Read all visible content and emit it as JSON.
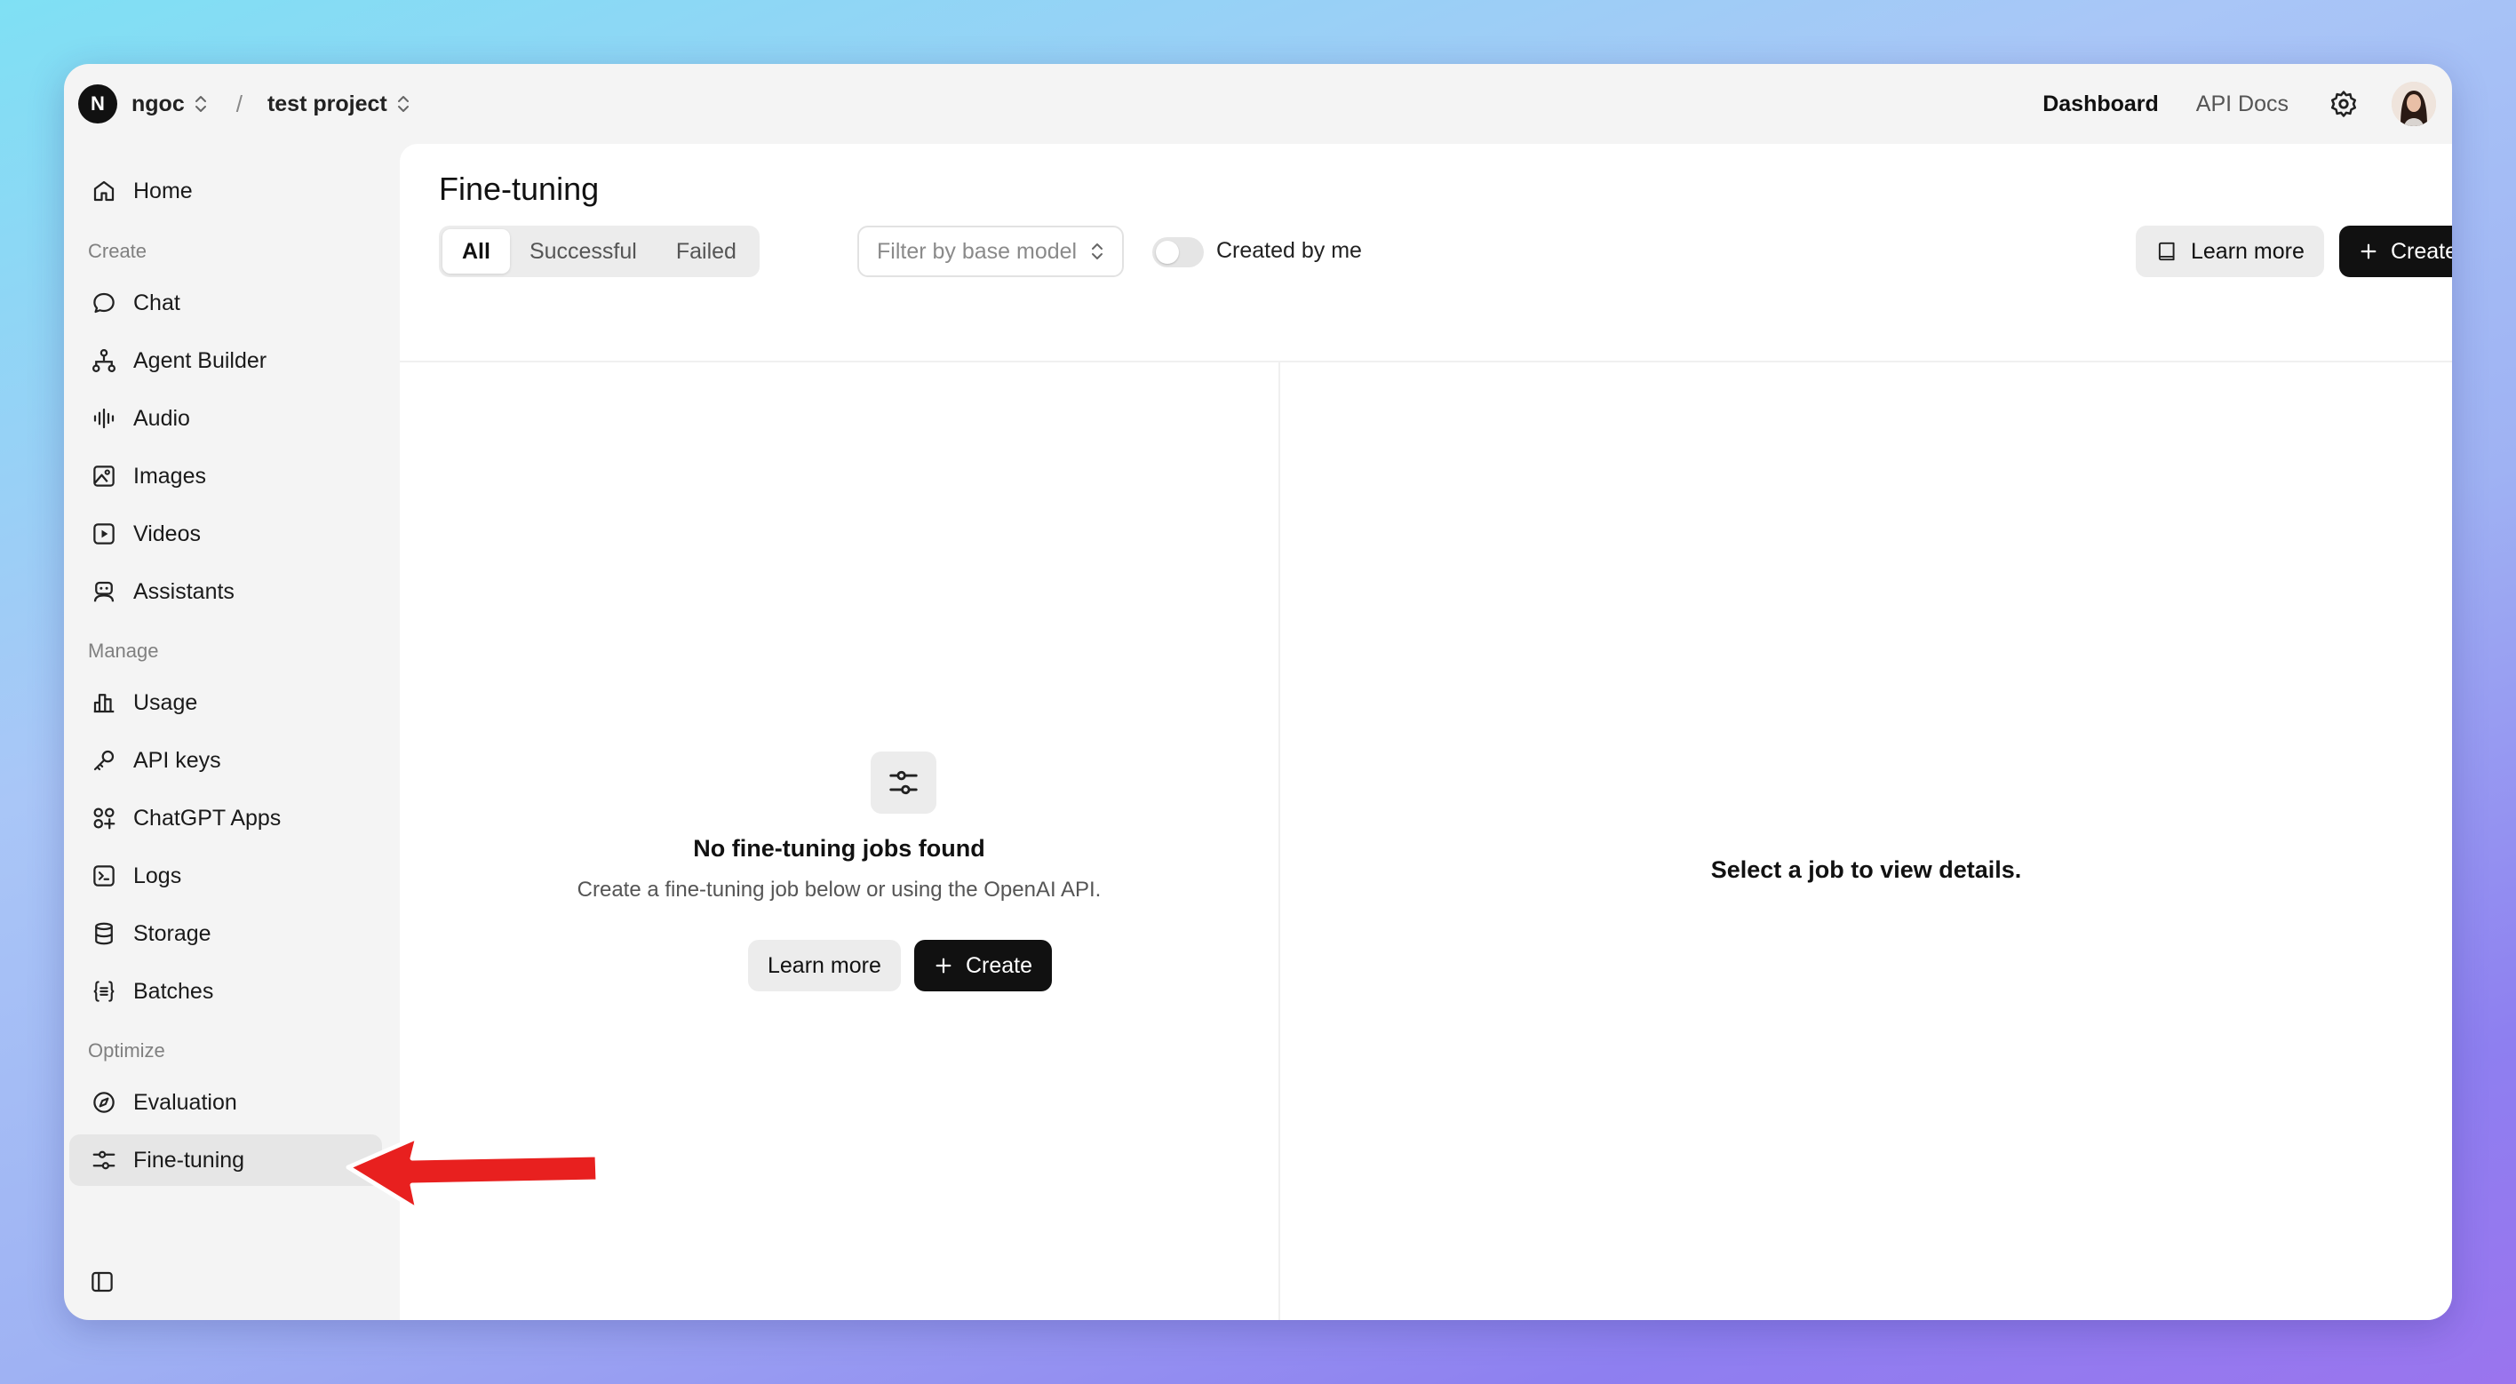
{
  "topbar": {
    "org_initial": "N",
    "org_name": "ngoc",
    "separator": "/",
    "project_name": "test project",
    "links": [
      "Dashboard",
      "API Docs"
    ]
  },
  "sidebar": {
    "home": "Home",
    "sections": {
      "create": "Create",
      "manage": "Manage",
      "optimize": "Optimize"
    },
    "create_items": [
      "Chat",
      "Agent Builder",
      "Audio",
      "Images",
      "Videos",
      "Assistants"
    ],
    "manage_items": [
      "Usage",
      "API keys",
      "ChatGPT Apps",
      "Logs",
      "Storage",
      "Batches"
    ],
    "optimize_items": [
      "Evaluation",
      "Fine-tuning"
    ],
    "active_item": "Fine-tuning"
  },
  "main": {
    "title": "Fine-tuning",
    "tabs": [
      "All",
      "Successful",
      "Failed"
    ],
    "active_tab": "All",
    "filter_placeholder": "Filter by base model",
    "toggle_label": "Created by me",
    "toggle_on": false,
    "learn_more": "Learn more",
    "create": "Create",
    "empty_state": {
      "title": "No fine-tuning jobs found",
      "description": "Create a fine-tuning job below or using the OpenAI API.",
      "learn_more": "Learn more",
      "create": "Create"
    },
    "detail_placeholder": "Select a job to view details."
  },
  "colors": {
    "accent": "#111111",
    "annotation_arrow": "#e8201f"
  }
}
